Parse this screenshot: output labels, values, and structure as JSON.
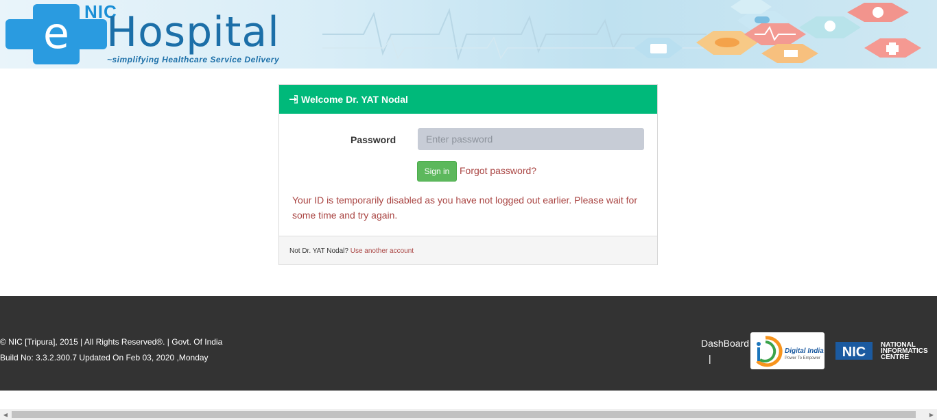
{
  "header": {
    "logo_nic": "NIC",
    "logo_e": "e",
    "logo_name": "Hospital",
    "tagline": "~simplifying Healthcare Service Delivery"
  },
  "login": {
    "title": "Welcome Dr. YAT Nodal",
    "password_label": "Password",
    "password_placeholder": "Enter password",
    "signin_label": "Sign in",
    "forgot_label": "Forgot password?",
    "error_message": "Your ID is temporarily disabled as you have not logged out earlier. Please wait for some time and try again.",
    "footer_prefix": "Not Dr. YAT Nodal?",
    "footer_link": "Use another account"
  },
  "footer": {
    "copyright": "© NIC [Tripura], 2015 | All Rights Reserved®. | Govt. Of India",
    "build": "Build No: 3.3.2.300.7 Updated On Feb 03, 2020 ,Monday",
    "dashboard": "DashBoard",
    "separator": "|",
    "digital_india_title": "Digital India",
    "digital_india_sub": "Power To Empower",
    "nic_line1": "NATIONAL",
    "nic_line2": "INFORMATICS",
    "nic_line3": "CENTRE"
  },
  "colors": {
    "accent_green": "#00b97a",
    "button_green": "#5cb85c",
    "error_red": "#a94442",
    "footer_bg": "#333333"
  },
  "icons": {
    "header": "sign-in-icon",
    "logo": "medical-cross-icon"
  }
}
